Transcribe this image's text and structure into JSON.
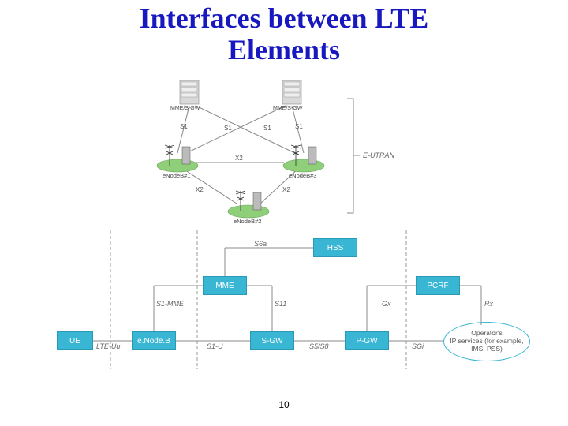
{
  "title_line1": "Interfaces between LTE",
  "title_line2": "Elements",
  "page_number": "10",
  "eutran": {
    "group_label": "E-UTRAN",
    "gw1": "MME/S-GW",
    "gw2": "MME/S-GW",
    "enb1": "eNodeB#1",
    "enb2": "eNodeB#2",
    "enb3": "eNodeB#3",
    "s1_a": "S1",
    "s1_b": "S1",
    "s1_c": "S1",
    "s1_d": "S1",
    "x2_top": "X2",
    "x2_left": "X2",
    "x2_right": "X2"
  },
  "epc": {
    "ue": "UE",
    "enodeb": "e.Node.B",
    "mme": "MME",
    "sgw": "S-GW",
    "pgw": "P-GW",
    "hss": "HSS",
    "pcrf": "PCRF",
    "operator": "Operator's\nIP services (for example,\nIMS, PSS)",
    "lte_uu": "LTE-Uu",
    "s1_mme": "S1-MME",
    "s1_u": "S1-U",
    "s11": "S11",
    "s5s8": "S5/S8",
    "s6a": "S6a",
    "gx": "Gx",
    "sgi": "SGi",
    "rx": "Rx"
  }
}
